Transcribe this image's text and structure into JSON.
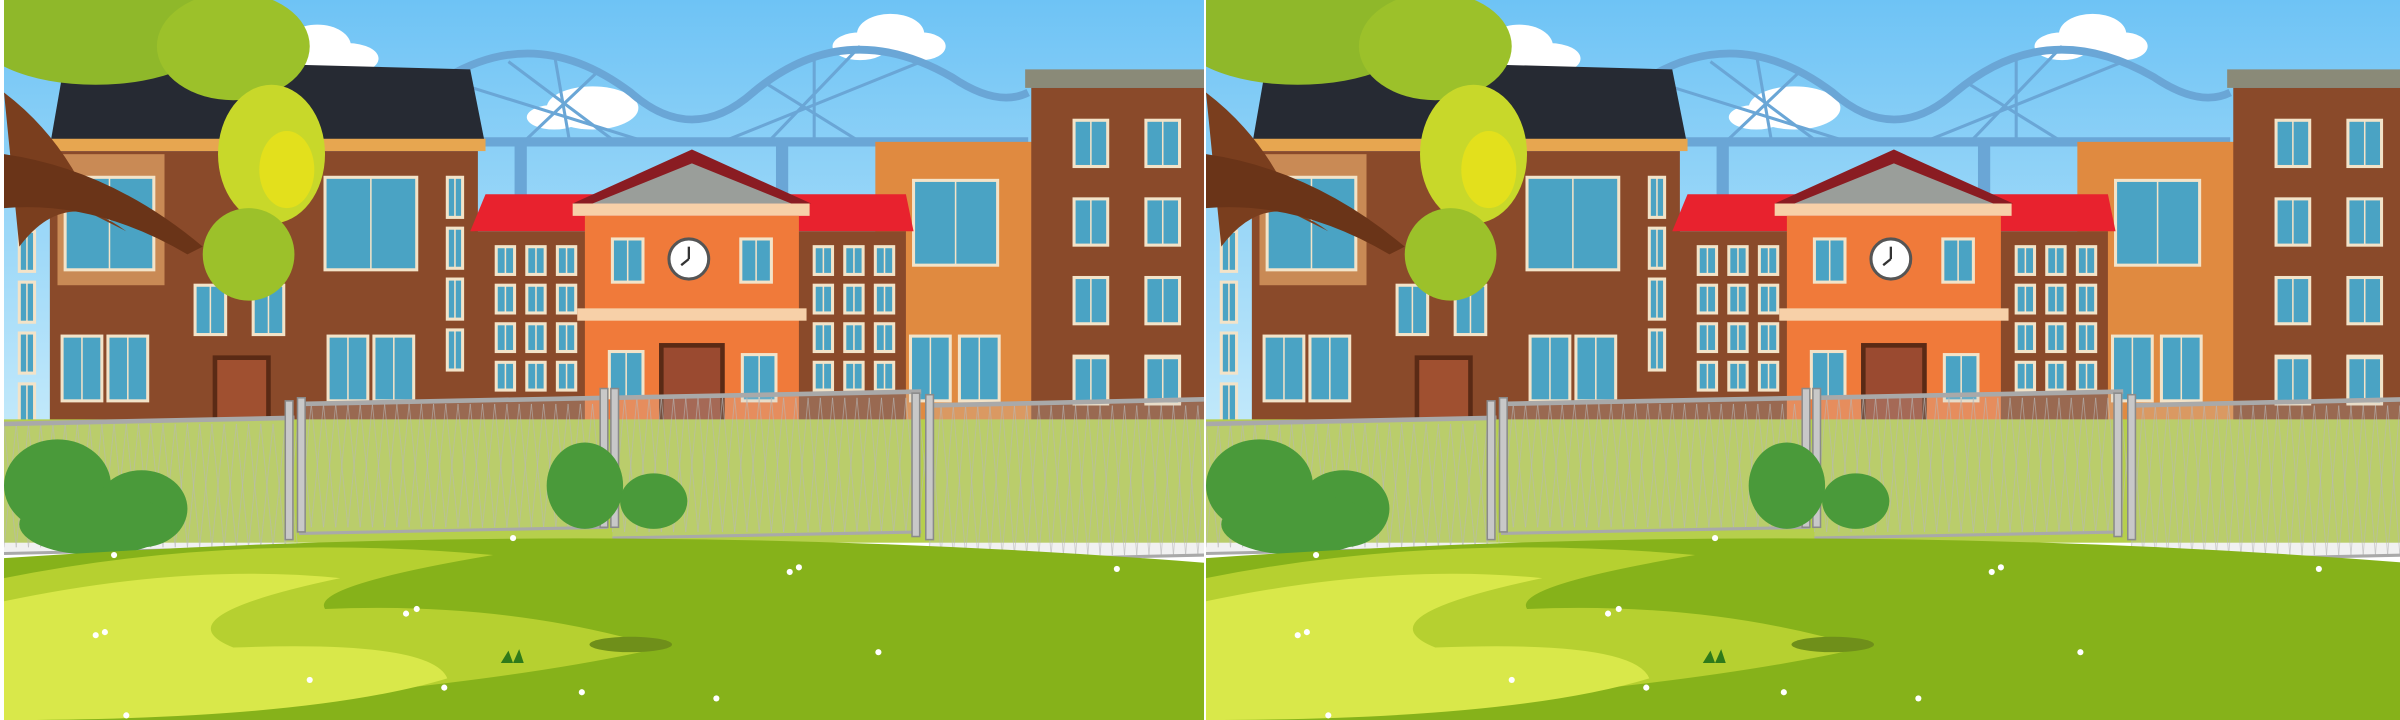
{
  "game": {
    "type": "spot-the-difference",
    "panels": [
      "left-scene",
      "right-scene"
    ]
  },
  "colors": {
    "sky_top": "#6ec3f5",
    "sky_bottom": "#c9ecfb",
    "bridge": "#6aa6d6",
    "brick": "#8a4a2a",
    "orange_wall": "#e08a40",
    "school_wall": "#f07a3a",
    "roof_red": "#e8222e",
    "roof_dark": "#262a33",
    "window": "#4aa3c4",
    "fence": "#a9a9a9",
    "grass_back": "#b6cf4c",
    "grass_front": "#86b21a",
    "grass_light": "#d9e84a",
    "tree": "#9cc12a",
    "bush": "#4a9a3a"
  }
}
